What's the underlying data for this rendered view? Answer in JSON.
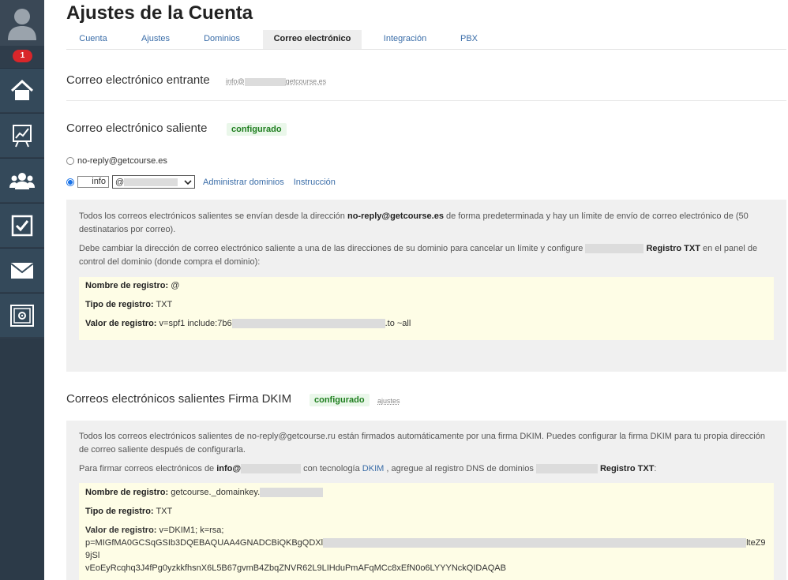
{
  "sidebar": {
    "notification_count": "1"
  },
  "page": {
    "title": "Ajustes de la Cuenta"
  },
  "tabs": [
    {
      "label": "Cuenta"
    },
    {
      "label": "Ajustes"
    },
    {
      "label": "Dominios"
    },
    {
      "label": "Correo electrónico"
    },
    {
      "label": "Integración"
    },
    {
      "label": "PBX"
    }
  ],
  "incoming": {
    "title": "Correo electrónico entrante",
    "address_prefix": "info@",
    "address_suffix": "getcourse.es"
  },
  "outgoing": {
    "title": "Correo electrónico saliente",
    "status": "configurado",
    "option_default": "no-reply@getcourse.es",
    "input_value": "info",
    "select_value": "@",
    "link_domains": "Administrar dominios",
    "link_instruction": "Instrucción",
    "text1_a": "Todos los correos electrónicos salientes se envían desde la dirección ",
    "text1_b": "no-reply@getcourse.es",
    "text1_c": " de forma predeterminada y hay un límite de envío de correo electrónico de (50 destinatarios por correo).",
    "text2_a": "Debe cambiar la dirección de correo electrónico saliente a una de las direcciones de su dominio para cancelar un límite   y configure ",
    "text2_b": "Registro TXT",
    "text2_c": " en el panel de control del dominio (donde compra el dominio):",
    "rec_name_label": "Nombre de registro:",
    "rec_name_value": "@",
    "rec_type_label": "Tipo de registro:",
    "rec_type_value": "TXT",
    "rec_value_label": "Valor de registro:",
    "rec_value_prefix": "v=spf1 include:7b6",
    "rec_value_suffix": ".to ~all"
  },
  "dkim": {
    "title": "Correos electrónicos salientes Firma DKIM",
    "status": "configurado",
    "settings_link": "ajustes",
    "text1": "Todos los correos electrónicos salientes de no-reply@getcourse.ru están firmados automáticamente por una firma DKIM. Puedes configurar la firma DKIM para tu propia dirección de correo saliente después de configurarla.",
    "text2_a": "Para firmar correos electrónicos de ",
    "text2_b": "info@",
    "text2_c": " con tecnología ",
    "text2_link": "DKIM",
    "text2_d": " , agregue al registro DNS de dominios ",
    "text2_e": "Registro TXT",
    "text2_f": ":",
    "rec_name_label": "Nombre de registro:",
    "rec_name_value": "getcourse._domainkey.",
    "rec_type_label": "Tipo de registro:",
    "rec_type_value": "TXT",
    "rec_value_label": "Valor de registro:",
    "rec_value_line1": "v=DKIM1; k=rsa;",
    "rec_value_line2_prefix": "p=MIGfMA0GCSqGSIb3DQEBAQUAA4GNADCBiQKBgQDXl",
    "rec_value_line2_suffix": "lteZ99jSl",
    "rec_value_line3": "vEoEyRcqhq3J4fPg0yzkkfhsnX6L5B67gvmB4ZbqZNVR62L9LIHduPmAFqMCc8xEfN0o6LYYYNckQIDAQAB"
  }
}
